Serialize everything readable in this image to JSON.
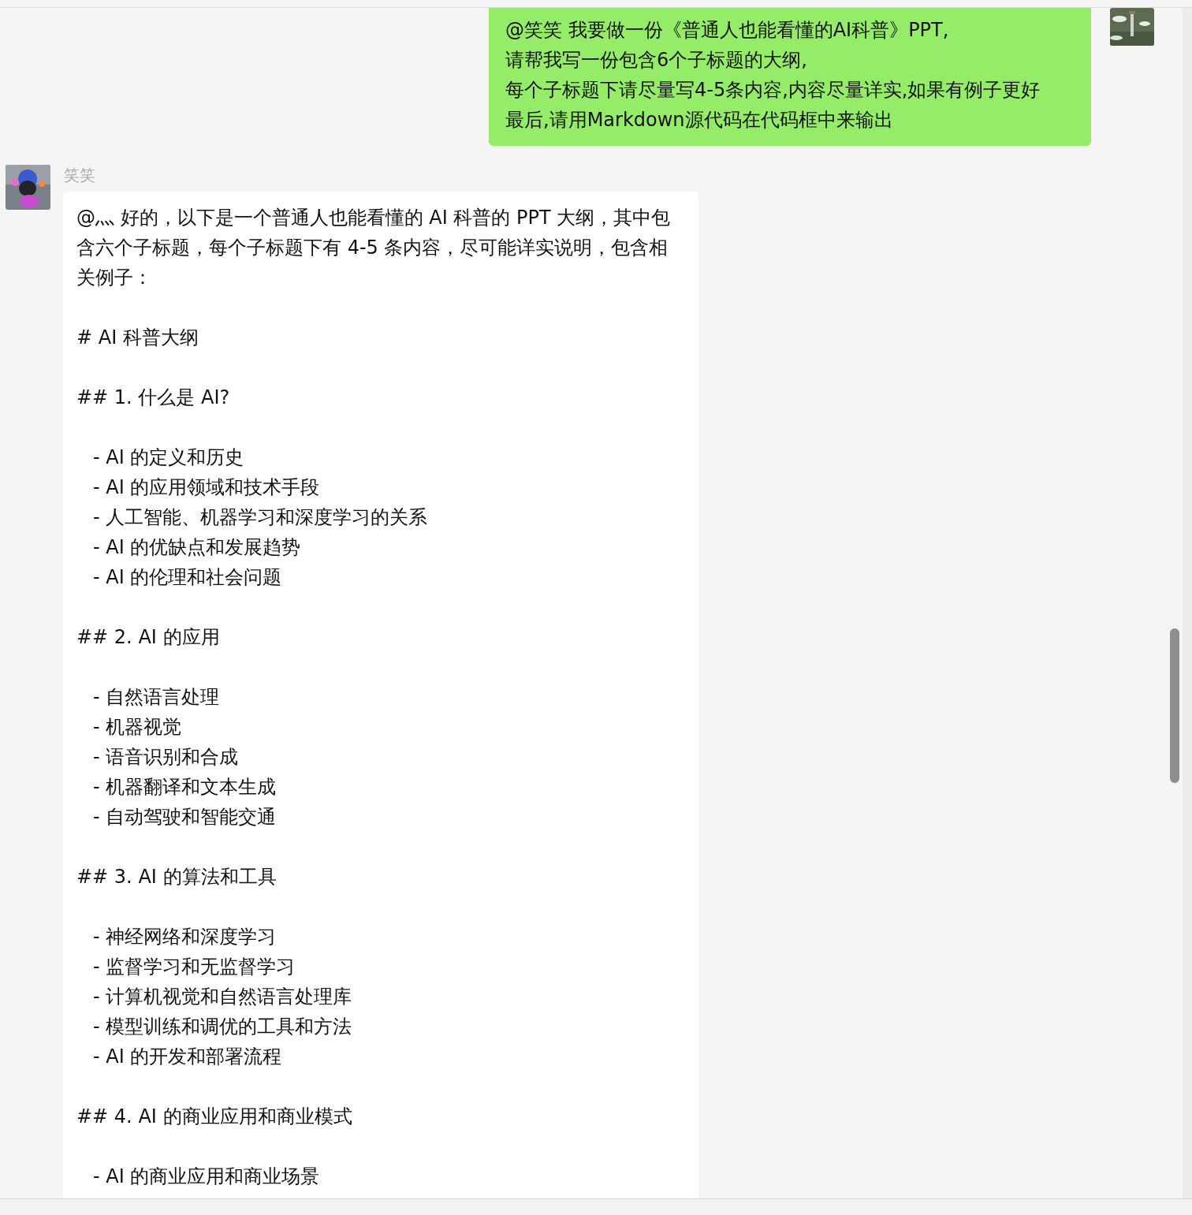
{
  "outgoing_message": {
    "lines": [
      "@笑笑 我要做一份《普通人也能看懂的AI科普》PPT,",
      "请帮我写一份包含6个子标题的大纲,",
      "每个子标题下请尽量写4-5条内容,内容尽量详实,如果有例子更好",
      "最后,请用Markdown源代码在代码框中来输出"
    ]
  },
  "incoming_message": {
    "sender": "笑笑",
    "blocks": [
      {
        "kind": "paragraph",
        "text": "@灬 好的，以下是一个普通人也能看懂的 AI 科普的 PPT 大纲，其中包含六个子标题，每个子标题下有 4-5 条内容，尽可能详实说明，包含相关例子："
      },
      {
        "kind": "heading",
        "text": "# AI 科普大纲"
      },
      {
        "kind": "heading",
        "text": "## 1. 什么是 AI?"
      },
      {
        "kind": "item",
        "text": "- AI 的定义和历史"
      },
      {
        "kind": "item",
        "text": "- AI 的应用领域和技术手段"
      },
      {
        "kind": "item",
        "text": "- 人工智能、机器学习和深度学习的关系"
      },
      {
        "kind": "item",
        "text": "- AI 的优缺点和发展趋势"
      },
      {
        "kind": "item",
        "text": "- AI 的伦理和社会问题"
      },
      {
        "kind": "heading",
        "text": "## 2. AI 的应用"
      },
      {
        "kind": "item",
        "text": "- 自然语言处理"
      },
      {
        "kind": "item",
        "text": "- 机器视觉"
      },
      {
        "kind": "item",
        "text": "- 语音识别和合成"
      },
      {
        "kind": "item",
        "text": "- 机器翻译和文本生成"
      },
      {
        "kind": "item",
        "text": "- 自动驾驶和智能交通"
      },
      {
        "kind": "heading",
        "text": "## 3. AI 的算法和工具"
      },
      {
        "kind": "item",
        "text": "- 神经网络和深度学习"
      },
      {
        "kind": "item",
        "text": "- 监督学习和无监督学习"
      },
      {
        "kind": "item",
        "text": "- 计算机视觉和自然语言处理库"
      },
      {
        "kind": "item",
        "text": "- 模型训练和调优的工具和方法"
      },
      {
        "kind": "item",
        "text": "- AI 的开发和部署流程"
      },
      {
        "kind": "heading",
        "text": "## 4. AI 的商业应用和商业模式"
      },
      {
        "kind": "item",
        "text": "- AI 的商业应用和商业场景"
      }
    ]
  }
}
